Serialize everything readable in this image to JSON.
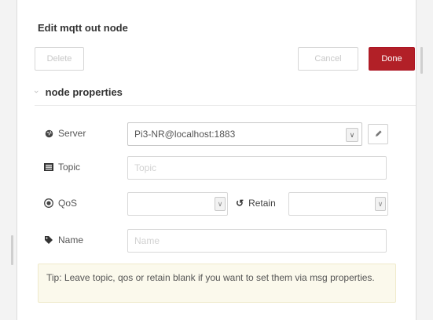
{
  "dialog": {
    "title": "Edit mqtt out node",
    "delete_label": "Delete",
    "cancel_label": "Cancel",
    "done_label": "Done",
    "accent_color": "#b22027"
  },
  "section": {
    "label": "node properties",
    "expand_icon": "chevron-right-icon"
  },
  "fields": {
    "server": {
      "label": "Server",
      "icon": "globe-icon",
      "value": "Pi3-NR@localhost:1883"
    },
    "topic": {
      "label": "Topic",
      "icon": "tasks-icon",
      "placeholder": "Topic"
    },
    "qos": {
      "label": "QoS",
      "icon": "empire-icon",
      "value": ""
    },
    "retain": {
      "label": "Retain",
      "icon": "history-icon",
      "value": ""
    },
    "name": {
      "label": "Name",
      "icon": "tag-icon",
      "placeholder": "Name"
    }
  },
  "tip": {
    "text": "Tip: Leave topic, qos or retain blank if you want to set them via msg properties."
  }
}
